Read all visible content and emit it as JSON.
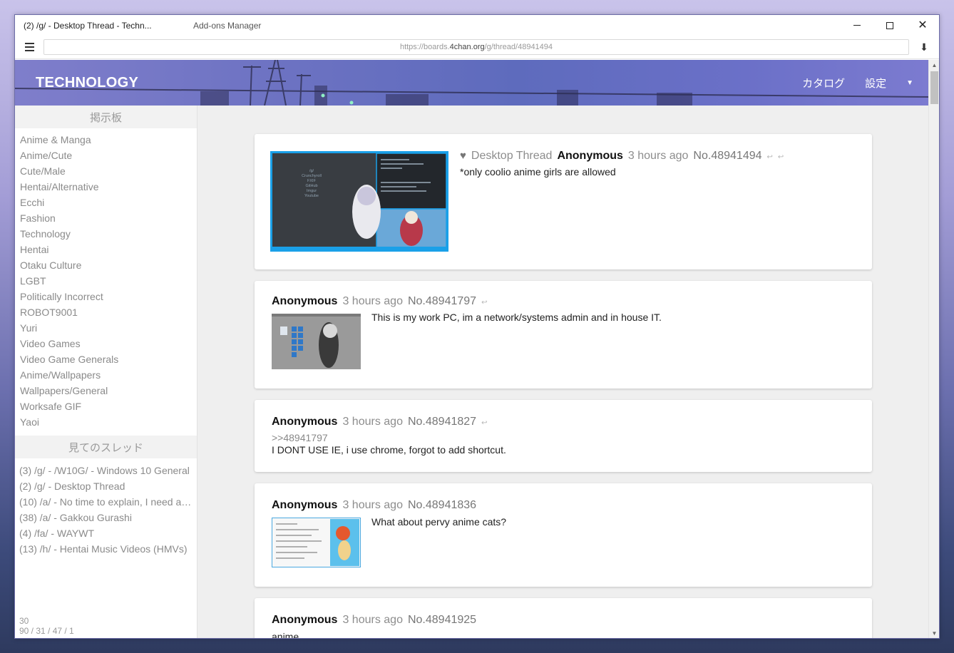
{
  "browser": {
    "active_tab_title": "(2) /g/ - Desktop Thread - Techn...",
    "inactive_tab_title": "Add-ons Manager",
    "url_prefix": "https://boards.",
    "url_domain": "4chan.org",
    "url_path": "/g/thread/48941494"
  },
  "header": {
    "board_title": "TECHNOLOGY",
    "catalog_label": "カタログ",
    "settings_label": "設定"
  },
  "sidebar": {
    "boards_heading": "掲示板",
    "boards": [
      "Anime & Manga",
      "Anime/Cute",
      "Cute/Male",
      "Hentai/Alternative",
      "Ecchi",
      "Fashion",
      "Technology",
      "Hentai",
      "Otaku Culture",
      "LGBT",
      "Politically Incorrect",
      "ROBOT9001",
      "Yuri",
      "Video Games",
      "Video Game Generals",
      "Anime/Wallpapers",
      "Wallpapers/General",
      "Worksafe GIF",
      "Yaoi"
    ],
    "watched_heading": "見てのスレッド",
    "watched": [
      "(3) /g/ - /W10G/ - Windows 10 General",
      "(2) /g/ - Desktop Thread",
      "(10) /a/ - No time to explain, I need all ...",
      "(38) /a/ - Gakkou Gurashi",
      "(4) /fa/ - WAYWT",
      "(13) /h/ - Hentai Music Videos (HMVs)"
    ],
    "stats_line1": "30",
    "stats_line2": "90 / 31 / 47 / 1"
  },
  "posts": [
    {
      "subject": "Desktop Thread",
      "name": "Anonymous",
      "time": "3 hours ago",
      "number": "No.48941494",
      "text": "*only coolio anime girls are allowed",
      "thumb_lines": [
        "/g/",
        "Crunchyroll",
        "FXIF",
        "GitHub",
        "Imgur",
        "Youtube"
      ]
    },
    {
      "name": "Anonymous",
      "time": "3 hours ago",
      "number": "No.48941797",
      "text": "This is my work PC, im a network/systems admin and in house IT."
    },
    {
      "name": "Anonymous",
      "time": "3 hours ago",
      "number": "No.48941827",
      "quote": ">>48941797",
      "text": "I DONT USE IE, i use chrome, forgot to add shortcut."
    },
    {
      "name": "Anonymous",
      "time": "3 hours ago",
      "number": "No.48941836",
      "text": "What about pervy anime cats?"
    },
    {
      "name": "Anonymous",
      "time": "3 hours ago",
      "number": "No.48941925",
      "text": "anime"
    }
  ],
  "icons": {
    "reply": "↩",
    "heart": "♥",
    "caret": "▼",
    "download": "⬇"
  }
}
